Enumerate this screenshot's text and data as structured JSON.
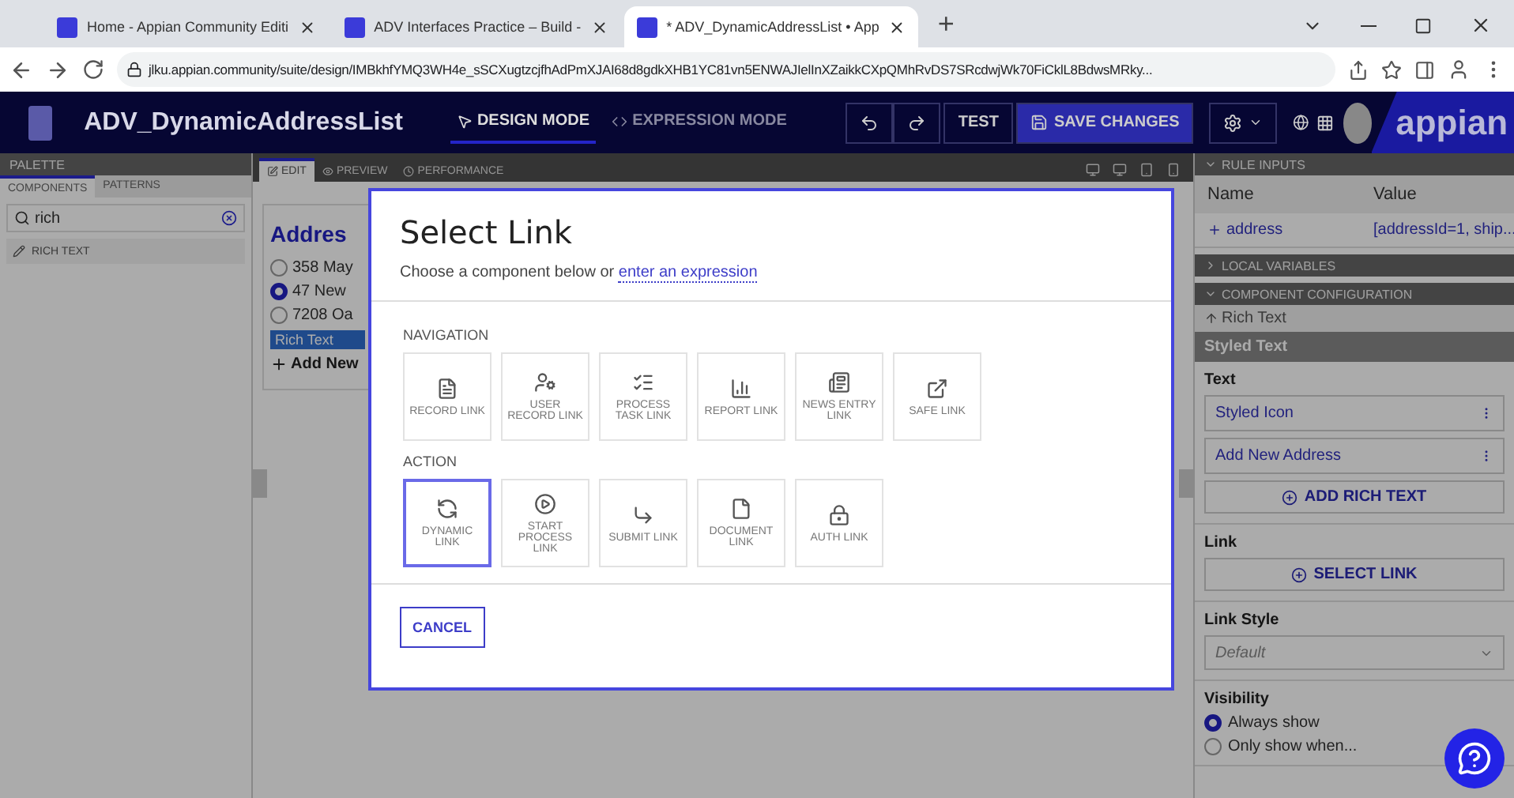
{
  "browser": {
    "tabs": [
      {
        "title": "Home - Appian Community Editi",
        "selected": false
      },
      {
        "title": "ADV Interfaces Practice – Build -",
        "selected": false
      },
      {
        "title": "* ADV_DynamicAddressList • App",
        "selected": true
      }
    ],
    "new_tab": "+",
    "url": "jlku.appian.community/suite/design/IMBkhfYMQ3WH4e_sSCXugtzcjfhAdPmXJAI68d8gdkXHB1YC81vn5ENWAJIelInXZaikkCXpQMhRvDS7SRcdwjWk70FiCklL8BdwsMRky..."
  },
  "app": {
    "title": "ADV_DynamicAddressList",
    "modes": [
      {
        "label": "DESIGN MODE",
        "selected": true
      },
      {
        "label": "EXPRESSION MODE",
        "selected": false
      }
    ],
    "test": "TEST",
    "save": "SAVE CHANGES",
    "logo": "appian"
  },
  "palette": {
    "title": "PALETTE",
    "tabs": [
      {
        "label": "COMPONENTS",
        "selected": true
      },
      {
        "label": "PATTERNS",
        "selected": false
      }
    ],
    "search": "rich",
    "results": [
      "RICH TEXT"
    ]
  },
  "canvas": {
    "tabs": [
      {
        "label": "EDIT",
        "selected": true
      },
      {
        "label": "PREVIEW",
        "selected": false
      },
      {
        "label": "PERFORMANCE",
        "selected": false
      }
    ],
    "heading": "Addres",
    "options": [
      {
        "label": "358 May",
        "selected": false
      },
      {
        "label": "47 New",
        "selected": true
      },
      {
        "label": "7208 Oa",
        "selected": false
      }
    ],
    "component_tag": "Rich Text",
    "add_link": "Add New"
  },
  "modal": {
    "title": "Select Link",
    "intro": "Choose a component below or",
    "intro_link": "enter an expression",
    "sections": [
      {
        "title": "NAVIGATION",
        "items": [
          {
            "label": "RECORD LINK",
            "selected": false
          },
          {
            "label": "USER RECORD LINK",
            "selected": false
          },
          {
            "label": "PROCESS TASK LINK",
            "selected": false
          },
          {
            "label": "REPORT LINK",
            "selected": false
          },
          {
            "label": "NEWS ENTRY LINK",
            "selected": false
          },
          {
            "label": "SAFE LINK",
            "selected": false
          }
        ]
      },
      {
        "title": "ACTION",
        "items": [
          {
            "label": "DYNAMIC LINK",
            "selected": true
          },
          {
            "label": "START PROCESS LINK",
            "selected": false
          },
          {
            "label": "SUBMIT LINK",
            "selected": false
          },
          {
            "label": "DOCUMENT LINK",
            "selected": false
          },
          {
            "label": "AUTH LINK",
            "selected": false
          }
        ]
      }
    ],
    "cancel": "CANCEL"
  },
  "inspector": {
    "rule_inputs": {
      "title": "RULE INPUTS",
      "columns": [
        "Name",
        "Value"
      ],
      "rows": [
        {
          "name": "address",
          "value": "[addressId=1, ship..."
        }
      ]
    },
    "local_variables": {
      "title": "LOCAL VARIABLES",
      "expanded": false
    },
    "configuration": {
      "title": "COMPONENT CONFIGURATION",
      "expanded": true,
      "breadcrumb": "Rich Text",
      "component": "Styled Text",
      "text_label": "Text",
      "text_items": [
        "Styled Icon",
        "Add New Address"
      ],
      "add_button": "ADD RICH TEXT",
      "link_label": "Link",
      "link_button": "SELECT LINK",
      "link_style_label": "Link Style",
      "link_style_placeholder": "Default",
      "visibility_label": "Visibility",
      "visibility_options": [
        {
          "label": "Always show",
          "selected": true
        },
        {
          "label": "Only show when...",
          "selected": false
        }
      ]
    }
  }
}
